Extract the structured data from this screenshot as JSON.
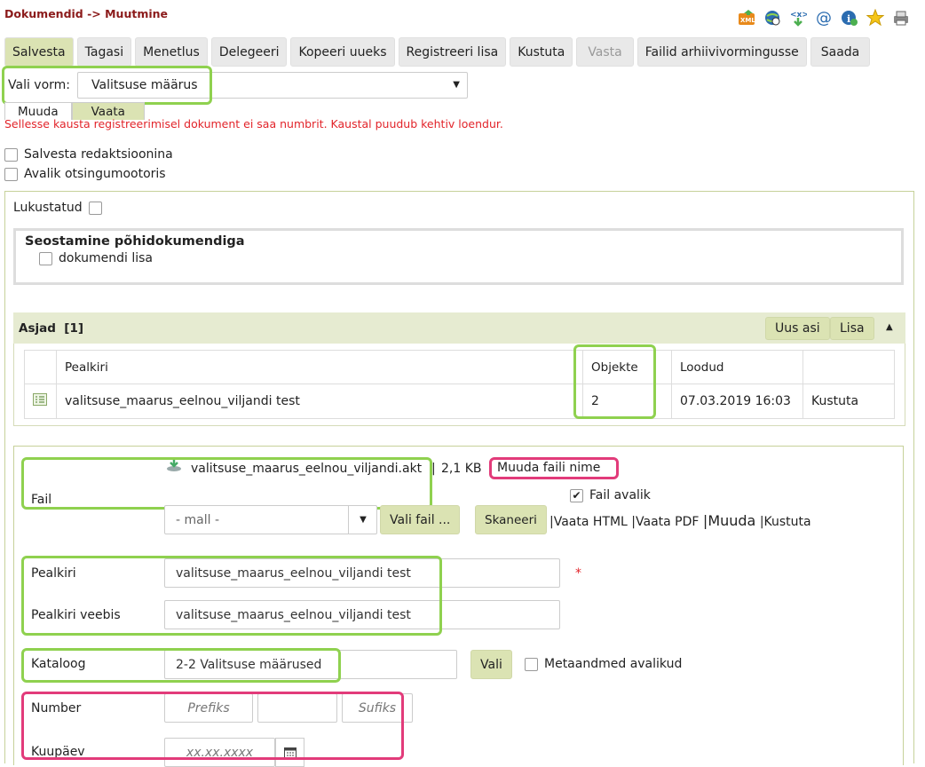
{
  "breadcrumb": "Dokumendid -> Muutmine",
  "top_icons": [
    "xml-icon",
    "globe-icon",
    "code-icon",
    "at-icon",
    "info-icon",
    "star-icon",
    "printer-icon"
  ],
  "toolbar": {
    "salvesta": "Salvesta",
    "tagasi": "Tagasi",
    "menetlus": "Menetlus",
    "delegeeri": "Delegeeri",
    "kopeeri": "Kopeeri uueks",
    "registreeri": "Registreeri lisa",
    "kustuta": "Kustuta",
    "vasta": "Vasta",
    "failid": "Failid arhiivivormingusse",
    "saada": "Saada"
  },
  "form_select": {
    "label": "Vali vorm:",
    "value": "Valitsuse määrus"
  },
  "subtabs": {
    "muuda": "Muuda",
    "vaata": "Vaata"
  },
  "error_message": "Sellesse kausta registreerimisel dokument ei saa numbrit. Kaustal puudub kehtiv loendur.",
  "options": {
    "salvesta_redaktsioonina": "Salvesta redaktsioonina",
    "avalik_otsingumootoris": "Avalik otsingumootoris"
  },
  "lukustatud": "Lukustatud",
  "seostamine": {
    "title": "Seostamine põhidokumendiga",
    "option": "dokumendi lisa"
  },
  "asjad": {
    "title": "Asjad",
    "count": "[1]",
    "uus_asi": "Uus asi",
    "lisa": "Lisa",
    "columns": {
      "pealkiri": "Pealkiri",
      "objekte": "Objekte",
      "loodud": "Loodud"
    },
    "rows": [
      {
        "pealkiri": "valitsuse_maarus_eelnou_viljandi test",
        "objekte": "2",
        "loodud": "07.03.2019 16:03",
        "action": "Kustuta"
      }
    ]
  },
  "file": {
    "label": "Fail",
    "name": "valitsuse_maarus_eelnou_viljandi.akt",
    "sep": "|",
    "size": "2,1 KB",
    "rename": "Muuda faili nime",
    "fail_avalik": "Fail avalik",
    "template_select": "- mall -",
    "vali_fail": "Vali fail ...",
    "skaneeri": "Skaneeri",
    "link_html": "|Vaata HTML",
    "link_pdf": "|Vaata PDF",
    "link_muuda": "|Muuda",
    "link_kustuta": "|Kustuta"
  },
  "fields": {
    "pealkiri_label": "Pealkiri",
    "pealkiri_value": "valitsuse_maarus_eelnou_viljandi test",
    "required_mark": "*",
    "pealkiri_veebis_label": "Pealkiri veebis",
    "pealkiri_veebis_value": "valitsuse_maarus_eelnou_viljandi test",
    "kataloog_label": "Kataloog",
    "kataloog_value": "2-2 Valitsuse määrused",
    "vali": "Vali",
    "metaandmed": "Metaandmed avalikud",
    "number_label": "Number",
    "prefiks": "Prefiks",
    "sufiks": "Sufiks",
    "kuupaev_label": "Kuupäev",
    "kuupaev_placeholder": "xx.xx.xxxx"
  },
  "colors": {
    "accent_green": "#8fd14f",
    "highlight_pink": "#e23b7a",
    "button_green": "#dbe3b3",
    "error_red": "#e2242a",
    "breadcrumb": "#8b1a1a"
  }
}
